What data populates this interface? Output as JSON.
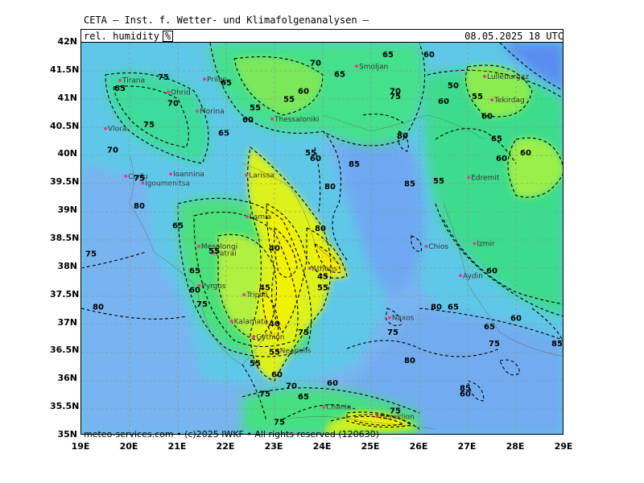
{
  "header": {
    "title": "CETA – Inst. f. Wetter- und Klimafolgenanalysen –",
    "parameter": "rel. humidity",
    "unit": "%",
    "datetime": "08.05.2025 18 UTC"
  },
  "footer": "meteo-services.com • (c)2025 IWKF • All rights reserved (120630)",
  "axes": {
    "lat_labels": [
      "42N",
      "41.5N",
      "41N",
      "40.5N",
      "40N",
      "39.5N",
      "39N",
      "38.5N",
      "38N",
      "37.5N",
      "37N",
      "36.5N",
      "36N",
      "35.5N",
      "35N"
    ],
    "lon_labels": [
      "19E",
      "20E",
      "21E",
      "22E",
      "23E",
      "24E",
      "25E",
      "26E",
      "27E",
      "28E",
      "29E"
    ],
    "lat_range": [
      35,
      42
    ],
    "lon_range": [
      19,
      29
    ]
  },
  "cities": [
    {
      "name": "Tirana",
      "lon": 19.8,
      "lat": 41.33
    },
    {
      "name": "Ohrid",
      "lon": 20.8,
      "lat": 41.12
    },
    {
      "name": "Prilep",
      "lon": 21.55,
      "lat": 41.35
    },
    {
      "name": "Florina",
      "lon": 21.4,
      "lat": 40.78
    },
    {
      "name": "Thessaloniki",
      "lon": 22.95,
      "lat": 40.64
    },
    {
      "name": "Smoljan",
      "lon": 24.7,
      "lat": 41.58
    },
    {
      "name": "Lulleburgaz",
      "lon": 27.35,
      "lat": 41.4
    },
    {
      "name": "Tekirdag",
      "lon": 27.5,
      "lat": 40.98
    },
    {
      "name": "Vlora",
      "lon": 19.5,
      "lat": 40.47
    },
    {
      "name": "Ioannina",
      "lon": 20.85,
      "lat": 39.66
    },
    {
      "name": "Corfu",
      "lon": 19.92,
      "lat": 39.62
    },
    {
      "name": "Igoumenitsa",
      "lon": 20.27,
      "lat": 39.5
    },
    {
      "name": "Larissa",
      "lon": 22.42,
      "lat": 39.64
    },
    {
      "name": "Edremit",
      "lon": 27.02,
      "lat": 39.6
    },
    {
      "name": "Lamia",
      "lon": 22.43,
      "lat": 38.9
    },
    {
      "name": "Mesolongi",
      "lon": 21.43,
      "lat": 38.37
    },
    {
      "name": "Patrai",
      "lon": 21.73,
      "lat": 38.25
    },
    {
      "name": "Athens",
      "lon": 23.73,
      "lat": 37.98
    },
    {
      "name": "Chios",
      "lon": 26.14,
      "lat": 38.37
    },
    {
      "name": "Izmir",
      "lon": 27.14,
      "lat": 38.42
    },
    {
      "name": "Pyrgos",
      "lon": 21.44,
      "lat": 37.67
    },
    {
      "name": "Aydin",
      "lon": 26.85,
      "lat": 37.85
    },
    {
      "name": "Tripoli",
      "lon": 22.37,
      "lat": 37.51
    },
    {
      "name": "Kalamata",
      "lon": 22.11,
      "lat": 37.04
    },
    {
      "name": "Naxos",
      "lon": 25.38,
      "lat": 37.1
    },
    {
      "name": "Gythion",
      "lon": 22.57,
      "lat": 36.76
    },
    {
      "name": "Neapolis",
      "lon": 23.06,
      "lat": 36.51
    },
    {
      "name": "Chania",
      "lon": 24.02,
      "lat": 35.51
    },
    {
      "name": "Heraklion",
      "lon": 25.13,
      "lat": 35.34
    }
  ],
  "contour_labels": [
    {
      "v": "65",
      "lon": 19.8,
      "lat": 41.2
    },
    {
      "v": "75",
      "lon": 20.7,
      "lat": 41.4
    },
    {
      "v": "70",
      "lon": 20.9,
      "lat": 40.93
    },
    {
      "v": "75",
      "lon": 20.4,
      "lat": 40.55
    },
    {
      "v": "70",
      "lon": 19.65,
      "lat": 40.1
    },
    {
      "v": "75",
      "lon": 20.2,
      "lat": 39.6
    },
    {
      "v": "80",
      "lon": 20.2,
      "lat": 39.1
    },
    {
      "v": "75",
      "lon": 19.2,
      "lat": 38.25
    },
    {
      "v": "80",
      "lon": 19.35,
      "lat": 37.3
    },
    {
      "v": "65",
      "lon": 22.0,
      "lat": 41.3
    },
    {
      "v": "65",
      "lon": 21.95,
      "lat": 40.4
    },
    {
      "v": "55",
      "lon": 22.6,
      "lat": 40.85
    },
    {
      "v": "60",
      "lon": 22.45,
      "lat": 40.64
    },
    {
      "v": "55",
      "lon": 23.3,
      "lat": 41.0
    },
    {
      "v": "60",
      "lon": 23.6,
      "lat": 41.15
    },
    {
      "v": "70",
      "lon": 23.85,
      "lat": 41.65
    },
    {
      "v": "65",
      "lon": 24.35,
      "lat": 41.45
    },
    {
      "v": "65",
      "lon": 25.35,
      "lat": 41.8
    },
    {
      "v": "60",
      "lon": 26.2,
      "lat": 41.8
    },
    {
      "v": "70",
      "lon": 25.5,
      "lat": 41.15
    },
    {
      "v": "75",
      "lon": 25.5,
      "lat": 41.05
    },
    {
      "v": "60",
      "lon": 26.5,
      "lat": 40.97
    },
    {
      "v": "80",
      "lon": 25.65,
      "lat": 40.35
    },
    {
      "v": "85",
      "lon": 24.65,
      "lat": 39.85
    },
    {
      "v": "50",
      "lon": 26.7,
      "lat": 41.25
    },
    {
      "v": "55",
      "lon": 27.2,
      "lat": 41.05
    },
    {
      "v": "60",
      "lon": 27.4,
      "lat": 40.7
    },
    {
      "v": "65",
      "lon": 27.6,
      "lat": 40.3
    },
    {
      "v": "60",
      "lon": 27.7,
      "lat": 39.95
    },
    {
      "v": "60",
      "lon": 28.2,
      "lat": 40.05
    },
    {
      "v": "55",
      "lon": 23.75,
      "lat": 40.05
    },
    {
      "v": "60",
      "lon": 23.85,
      "lat": 39.95
    },
    {
      "v": "85",
      "lon": 25.8,
      "lat": 39.5
    },
    {
      "v": "80",
      "lon": 24.15,
      "lat": 39.45
    },
    {
      "v": "55",
      "lon": 26.4,
      "lat": 39.55
    },
    {
      "v": "65",
      "lon": 21.0,
      "lat": 38.75
    },
    {
      "v": "55",
      "lon": 21.75,
      "lat": 38.3
    },
    {
      "v": "65",
      "lon": 21.35,
      "lat": 37.95
    },
    {
      "v": "60",
      "lon": 21.35,
      "lat": 37.6
    },
    {
      "v": "75",
      "lon": 21.5,
      "lat": 37.35
    },
    {
      "v": "40",
      "lon": 23.0,
      "lat": 38.35
    },
    {
      "v": "45",
      "lon": 22.8,
      "lat": 37.65
    },
    {
      "v": "40",
      "lon": 23.0,
      "lat": 37.0
    },
    {
      "v": "55",
      "lon": 24.0,
      "lat": 37.65
    },
    {
      "v": "45",
      "lon": 24.0,
      "lat": 37.85
    },
    {
      "v": "75",
      "lon": 23.6,
      "lat": 36.85
    },
    {
      "v": "80",
      "lon": 23.95,
      "lat": 38.7
    },
    {
      "v": "55",
      "lon": 22.6,
      "lat": 36.3
    },
    {
      "v": "55",
      "lon": 23.0,
      "lat": 36.5
    },
    {
      "v": "60",
      "lon": 23.05,
      "lat": 36.1
    },
    {
      "v": "70",
      "lon": 23.35,
      "lat": 35.9
    },
    {
      "v": "75",
      "lon": 22.8,
      "lat": 35.75
    },
    {
      "v": "65",
      "lon": 23.6,
      "lat": 35.7
    },
    {
      "v": "60",
      "lon": 24.2,
      "lat": 35.95
    },
    {
      "v": "75",
      "lon": 23.1,
      "lat": 35.25
    },
    {
      "v": "75",
      "lon": 25.5,
      "lat": 35.45
    },
    {
      "v": "80",
      "lon": 25.8,
      "lat": 36.35
    },
    {
      "v": "75",
      "lon": 25.45,
      "lat": 36.85
    },
    {
      "v": "80",
      "lon": 26.35,
      "lat": 37.3
    },
    {
      "v": "65",
      "lon": 26.7,
      "lat": 37.3
    },
    {
      "v": "60",
      "lon": 27.5,
      "lat": 37.95
    },
    {
      "v": "65",
      "lon": 27.45,
      "lat": 36.95
    },
    {
      "v": "75",
      "lon": 27.55,
      "lat": 36.65
    },
    {
      "v": "60",
      "lon": 28.0,
      "lat": 37.1
    },
    {
      "v": "85",
      "lon": 28.85,
      "lat": 36.65
    },
    {
      "v": "85",
      "lon": 26.95,
      "lat": 35.85
    },
    {
      "v": "60",
      "lon": 26.95,
      "lat": 35.75
    }
  ]
}
